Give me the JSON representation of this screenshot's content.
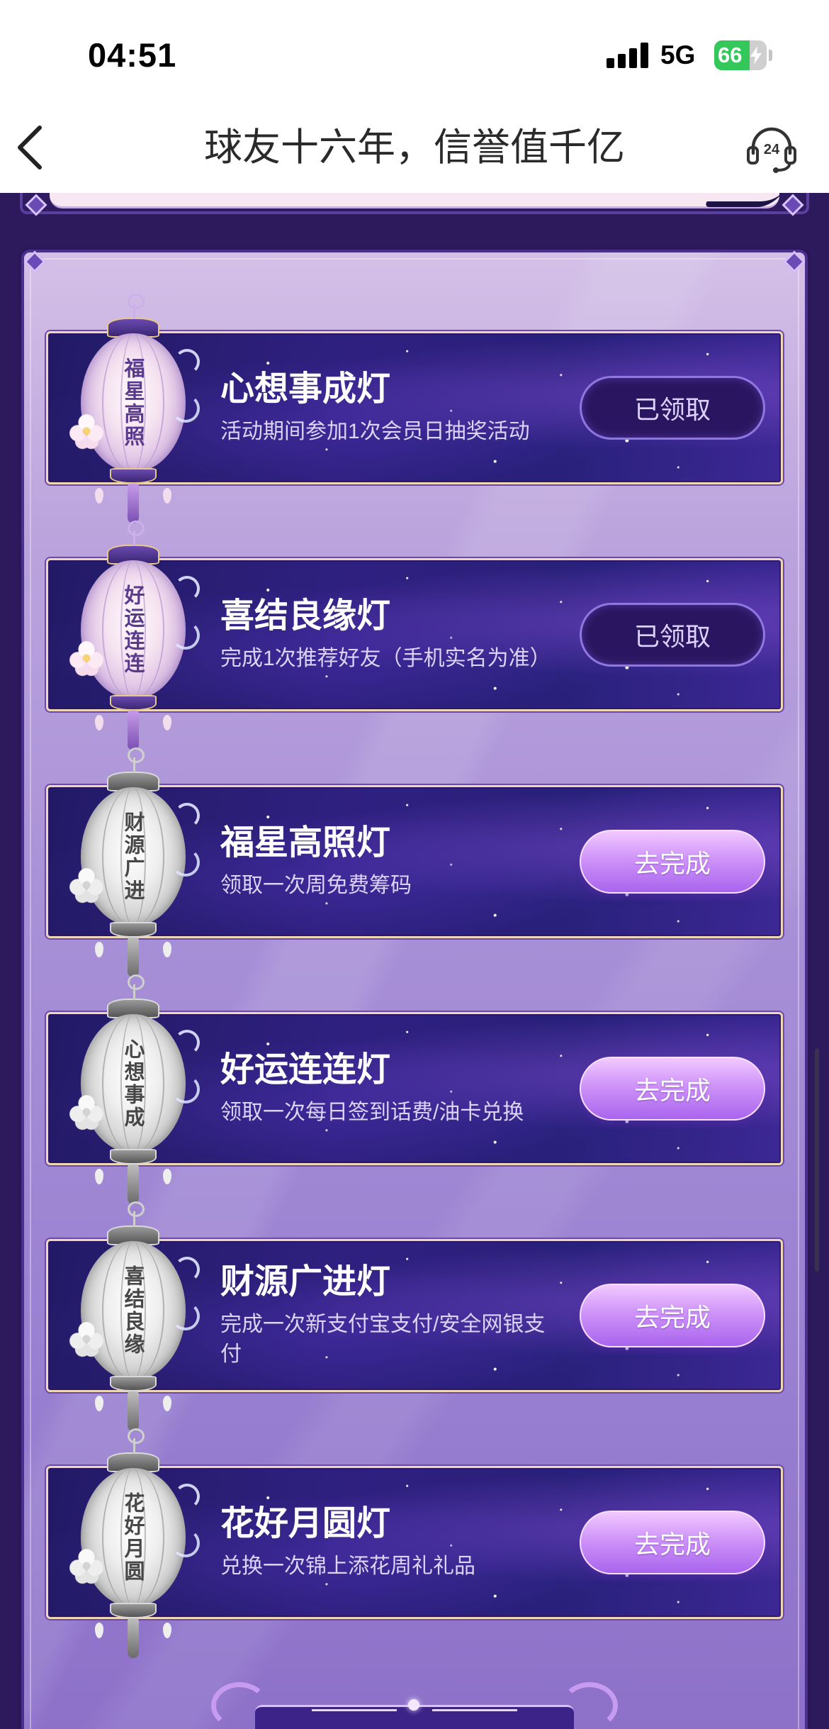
{
  "status_bar": {
    "time": "04:51",
    "network": "5G",
    "battery": "66",
    "battery_level_percent": 66,
    "icons": [
      "cellular-signal-icon",
      "battery-icon",
      "charging-bolt-icon"
    ]
  },
  "nav": {
    "title": "球友十六年，信誉值千亿",
    "back_icon": "chevron-left-icon",
    "support_icon": "headset-24-icon",
    "support_badge": "24"
  },
  "tasks": [
    {
      "title": "心想事成灯",
      "description": "活动期间参加1次会员日抽奖活动",
      "button": "已领取",
      "lantern_text": "福星高照"
    },
    {
      "title": "喜结良缘灯",
      "description": "完成1次推荐好友（手机实名为准）",
      "button": "已领取",
      "lantern_text": "好运连连"
    },
    {
      "title": "福星高照灯",
      "description": "领取一次周免费筹码",
      "button": "去完成",
      "lantern_text": "财源广进"
    },
    {
      "title": "好运连连灯",
      "description": "领取一次每日签到话费/油卡兑换",
      "button": "去完成",
      "lantern_text": "心想事成"
    },
    {
      "title": "财源广进灯",
      "description": "完成一次新支付宝支付/安全网银支付",
      "button": "去完成",
      "lantern_text": "喜结良缘"
    },
    {
      "title": "花好月圆灯",
      "description": "兑换一次锦上添花周礼礼品",
      "button": "去完成",
      "lantern_text": "花好月圆"
    }
  ],
  "colors": {
    "page_background": "#2c1a5c",
    "panel_top": "#d4c0e7",
    "panel_bottom": "#8d71c9",
    "card_background": "#2f2080",
    "card_border": "#efd6b6",
    "claimed_button": "#2a1660",
    "action_button": "#c78cf7",
    "battery_green": "#34c759"
  }
}
